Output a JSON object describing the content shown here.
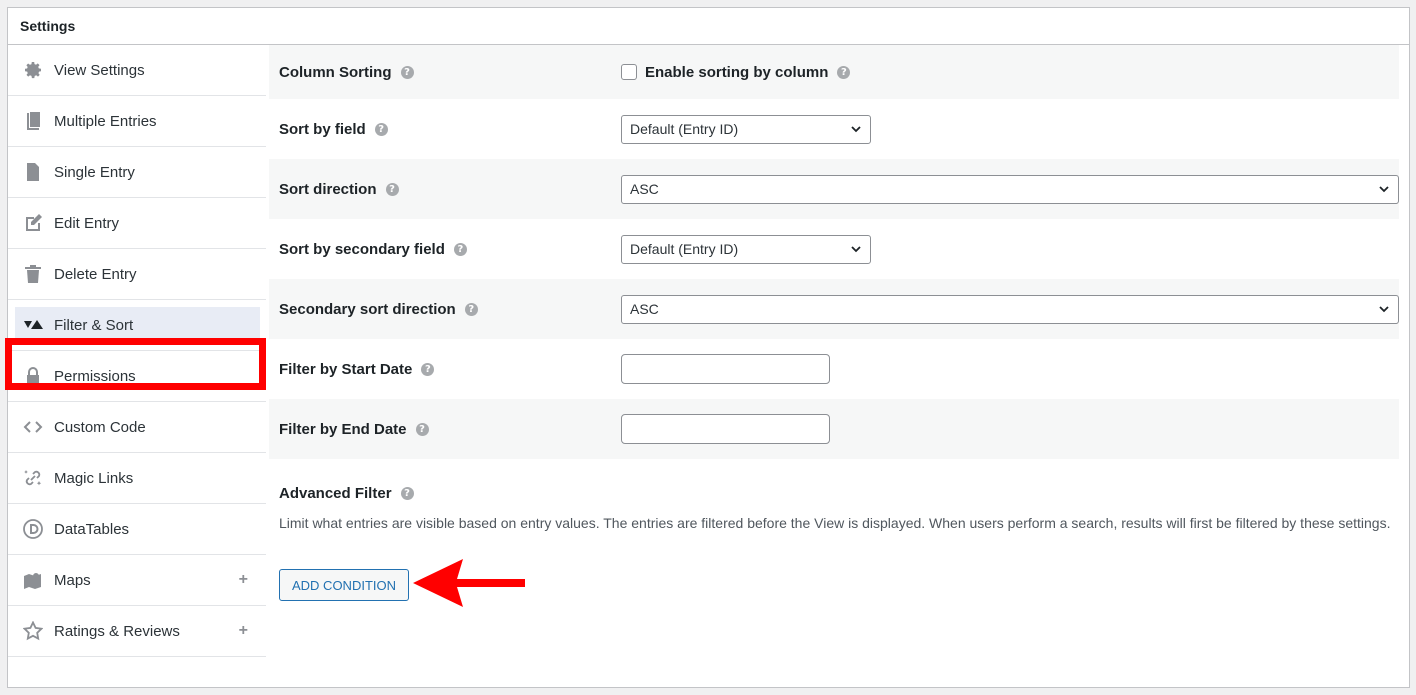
{
  "header": {
    "title": "Settings"
  },
  "sidebar": {
    "items": [
      {
        "label": "View Settings",
        "icon": "gear-icon"
      },
      {
        "label": "Multiple Entries",
        "icon": "multiple-pages-icon"
      },
      {
        "label": "Single Entry",
        "icon": "page-icon"
      },
      {
        "label": "Edit Entry",
        "icon": "edit-page-icon"
      },
      {
        "label": "Delete Entry",
        "icon": "trash-icon"
      },
      {
        "label": "Filter & Sort",
        "icon": "filter-sort-icon",
        "active": true
      },
      {
        "label": "Permissions",
        "icon": "lock-icon"
      },
      {
        "label": "Custom Code",
        "icon": "code-icon"
      },
      {
        "label": "Magic Links",
        "icon": "magic-link-icon"
      },
      {
        "label": "DataTables",
        "icon": "datatables-icon"
      },
      {
        "label": "Maps",
        "icon": "map-icon",
        "expandable": true
      },
      {
        "label": "Ratings & Reviews",
        "icon": "star-icon",
        "expandable": true
      }
    ]
  },
  "settings": {
    "column_sorting": {
      "label": "Column Sorting",
      "checkbox_label": "Enable sorting by column",
      "checked": false
    },
    "sort_by_field": {
      "label": "Sort by field",
      "value": "Default (Entry ID)"
    },
    "sort_direction": {
      "label": "Sort direction",
      "value": "ASC"
    },
    "sort_by_secondary_field": {
      "label": "Sort by secondary field",
      "value": "Default (Entry ID)"
    },
    "secondary_sort_direction": {
      "label": "Secondary sort direction",
      "value": "ASC"
    },
    "filter_start_date": {
      "label": "Filter by Start Date",
      "value": ""
    },
    "filter_end_date": {
      "label": "Filter by End Date",
      "value": ""
    },
    "advanced_filter": {
      "label": "Advanced Filter",
      "description": "Limit what entries are visible based on entry values. The entries are filtered before the View is displayed. When users perform a search, results will first be filtered by these settings.",
      "button_label": "ADD CONDITION"
    }
  },
  "help_glyph": "?",
  "expand_glyph": "+",
  "colors": {
    "annotation": "#ff0000",
    "accent": "#2271b1"
  }
}
